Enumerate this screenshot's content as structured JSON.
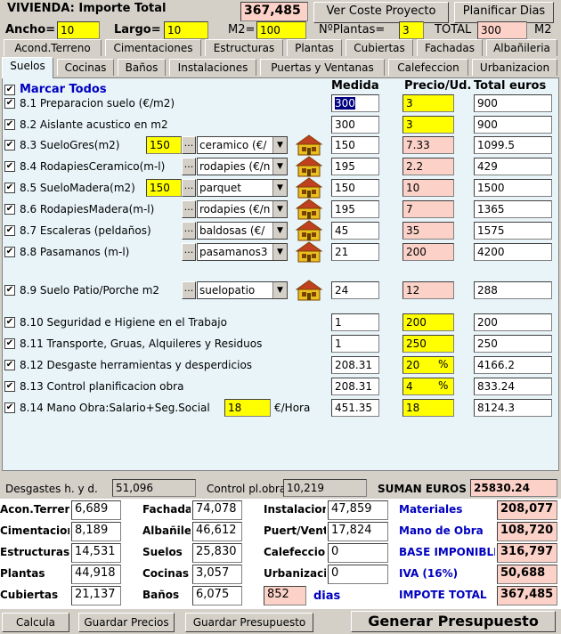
{
  "header": {
    "title": "VIVIENDA: Importe Total",
    "total_value": "367,485",
    "ver_coste_button": "Ver Coste Proyecto",
    "planificar_button": "Planificar Dias",
    "ancho_label": "Ancho=",
    "ancho_value": "10",
    "largo_label": "Largo=",
    "largo_value": "10",
    "m2_label": "M2=",
    "m2_value": "100",
    "nplantas_label": "NºPlantas=",
    "nplantas_value": "3",
    "total_label": "TOTAL",
    "total_m2_value": "300",
    "total_unit": "M2"
  },
  "tabs_row1": [
    "Acond.Terreno",
    "Cimentaciones",
    "Estructuras",
    "Plantas",
    "Cubiertas",
    "Fachadas",
    "Albañileria"
  ],
  "tabs_row2": [
    "Suelos",
    "Cocinas",
    "Baños",
    "Instalaciones",
    "Puertas y Ventanas",
    "Calefeccion",
    "Urbanizacion"
  ],
  "table": {
    "marcar_todos": "Marcar Todos",
    "col_medida": "Medida",
    "col_precio": "Precio/Ud.",
    "col_total": "Total euros",
    "rows": [
      {
        "label": "8.1 Preparacion suelo (€/m2)",
        "medida": "300",
        "precio": "3",
        "total": "900"
      },
      {
        "label": "8.2 Aislante acustico en m2",
        "medida": "300",
        "precio": "3",
        "total": "900"
      },
      {
        "label": "8.3 SueloGres(m2)",
        "qty": "150",
        "select": "ceramico (€/",
        "medida": "150",
        "precio": "7.33",
        "total": "1099.5"
      },
      {
        "label": "8.4 RodapiesCeramico(m-l)",
        "select": "rodapies (€/n",
        "medida": "195",
        "precio": "2.2",
        "total": "429"
      },
      {
        "label": "8.5 SueloMadera(m2)",
        "qty": "150",
        "select": "parquet",
        "medida": "150",
        "precio": "10",
        "total": "1500"
      },
      {
        "label": "8.6 RodapiesMadera(m-l)",
        "select": "rodapies (€/n",
        "medida": "195",
        "precio": "7",
        "total": "1365"
      },
      {
        "label": "8.7 Escaleras (peldaños)",
        "select": "baldosas (€/",
        "medida": "45",
        "precio": "35",
        "total": "1575"
      },
      {
        "label": "8.8 Pasamanos  (m-l)",
        "select": "pasamanos3",
        "medida": "21",
        "precio": "200",
        "total": "4200"
      },
      {
        "label": "8.9 Suelo Patio/Porche m2",
        "select": "suelopatio",
        "medida": "24",
        "precio": "12",
        "total": "288"
      },
      {
        "label": "8.10 Seguridad e Higiene en el Trabajo",
        "medida": "1",
        "precio": "200",
        "total": "200"
      },
      {
        "label": "8.11 Transporte, Gruas, Alquileres y Residuos",
        "medida": "1",
        "precio": "250",
        "total": "250"
      },
      {
        "label": "8.12 Desgaste herramientas y desperdicios",
        "medida": "208.31",
        "precio": "20",
        "unit": "%",
        "total": "4166.2"
      },
      {
        "label": "8.13 Control planificacion obra",
        "medida": "208.31",
        "precio": "4",
        "unit": "%",
        "total": "833.24"
      },
      {
        "label": "8.14 Mano Obra:Salario+Seg.Social",
        "qty": "18",
        "qty_unit": "€/Hora",
        "medida": "451.35",
        "precio": "18",
        "total": "8124.3"
      }
    ]
  },
  "footer_bar": {
    "desgastes_label": "Desgastes h. y d.",
    "desgastes_value": "51,096",
    "control_label": "Control pl.obra",
    "control_value": "10,219",
    "suman_label": "SUMAN EUROS",
    "suman_value": "25830.24"
  },
  "summary": {
    "col1": [
      {
        "label": "Acon.Terreno",
        "value": "6,689"
      },
      {
        "label": "Cimentaciones",
        "value": "8,189"
      },
      {
        "label": "Estructuras",
        "value": "14,531"
      },
      {
        "label": "Plantas",
        "value": "44,918"
      },
      {
        "label": "Cubiertas",
        "value": "21,137"
      }
    ],
    "col2": [
      {
        "label": "Fachadas",
        "value": "74,078"
      },
      {
        "label": "Albañileria",
        "value": "46,612"
      },
      {
        "label": "Suelos",
        "value": "25,830"
      },
      {
        "label": "Cocinas",
        "value": "3,057"
      },
      {
        "label": "Baños",
        "value": "6,075"
      }
    ],
    "col3": [
      {
        "label": "Instalaciones",
        "value": "47,859"
      },
      {
        "label": "Puert/Vent",
        "value": "17,824"
      },
      {
        "label": "Calefeccion",
        "value": "0"
      },
      {
        "label": "Urbanizacion",
        "value": "0"
      }
    ],
    "dias_value": "852",
    "dias_label": "dias",
    "col4": [
      {
        "label": "Materiales",
        "value": "208,077"
      },
      {
        "label": "Mano de Obra",
        "value": "108,720"
      },
      {
        "label": "BASE IMPONIBLE",
        "value": "316,797"
      },
      {
        "label": "IVA (16%)",
        "value": "50,688"
      },
      {
        "label": "IMPOTE TOTAL",
        "value": "367,485"
      }
    ]
  },
  "buttons": {
    "calcula": "Calcula",
    "guardar_precios": "Guardar Precios",
    "guardar_presupuesto": "Guardar Presupuesto",
    "generar": "Generar Presupuesto"
  },
  "check_mark": "✔",
  "dots_label": "...",
  "colors": {
    "yellow": "#ffff00",
    "pink": "#fcd2c8",
    "blue": "#0000c0",
    "panel": "#e8f4f8"
  }
}
